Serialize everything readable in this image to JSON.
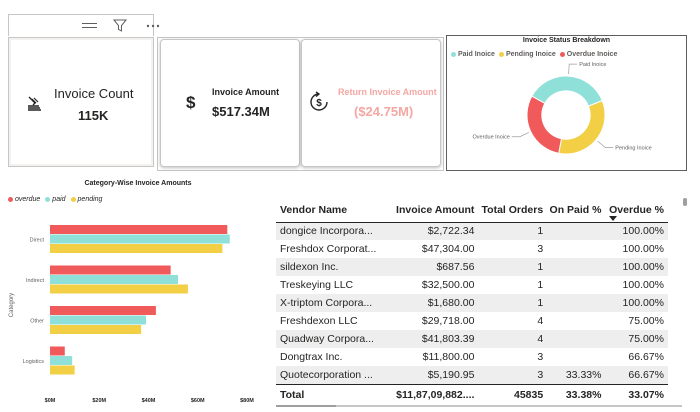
{
  "cards": {
    "invoice_count": {
      "label": "Invoice Count",
      "value": "115K",
      "icon": "stack-icon"
    },
    "invoice_amount": {
      "label": "Invoice Amount",
      "value": "$517.34M",
      "icon": "dollar-icon"
    },
    "return_amount": {
      "label": "Return Invoice Amount",
      "value": "($24.75M)",
      "icon": "refund-icon",
      "color": "#f4a7a3"
    }
  },
  "chart_data": [
    {
      "type": "pie",
      "title": "Invoice Status Breakdown",
      "legend_position": "top",
      "labels": [
        "Paid Inoice",
        "Pending Inoice",
        "Overdue Inoice"
      ],
      "values": [
        36,
        34,
        30
      ],
      "colors": [
        "#8fe0d8",
        "#f2cf44",
        "#f05a5b"
      ],
      "hole": 0.62
    },
    {
      "type": "bar",
      "orientation": "horizontal",
      "title": "Category-Wise Invoice Amounts",
      "legend_position": "top-left",
      "xlabel": "",
      "ylabel": "Category",
      "categories": [
        "Direct",
        "Indirect",
        "Other",
        "Logistics"
      ],
      "series": [
        {
          "name": "overdue",
          "color": "#f05a5b",
          "values": [
            72,
            49,
            43,
            6
          ]
        },
        {
          "name": "paid",
          "color": "#8fe0d8",
          "values": [
            73,
            52,
            39,
            9
          ]
        },
        {
          "name": "pending",
          "color": "#f2cf44",
          "values": [
            70,
            56,
            37,
            10
          ]
        }
      ],
      "xlim": [
        0,
        80
      ],
      "xticks": [
        0,
        20,
        40,
        60,
        80
      ],
      "xtick_labels": [
        "$0M",
        "$20M",
        "$40M",
        "$60M",
        "$80M"
      ],
      "grid": false
    }
  ],
  "table": {
    "columns": [
      "Vendor Name",
      "Invoice Amount",
      "Total Orders",
      "On Paid %",
      "Overdue %"
    ],
    "sorted_column": "Overdue %",
    "rows": [
      [
        "dongice Incorpora...",
        "$2,722.34",
        "1",
        "",
        "100.00%"
      ],
      [
        "Freshdox Corporat...",
        "$47,304.00",
        "3",
        "",
        "100.00%"
      ],
      [
        "sildexon Inc.",
        "$687.56",
        "1",
        "",
        "100.00%"
      ],
      [
        "Treskeying LLC",
        "$32,500.00",
        "1",
        "",
        "100.00%"
      ],
      [
        "X-triptom Corpora...",
        "$1,680.00",
        "1",
        "",
        "100.00%"
      ],
      [
        "Freshdexon LLC",
        "$29,718.00",
        "4",
        "",
        "75.00%"
      ],
      [
        "Quadway Corpora...",
        "$41,803.39",
        "4",
        "",
        "75.00%"
      ],
      [
        "Dongtrax Inc.",
        "$11,800.00",
        "3",
        "",
        "66.67%"
      ],
      [
        "Quotecorporation ...",
        "$5,190.95",
        "3",
        "33.33%",
        "66.67%"
      ]
    ],
    "total": [
      "Total",
      "$11,87,09,882....",
      "45835",
      "33.38%",
      "33.07%"
    ]
  }
}
